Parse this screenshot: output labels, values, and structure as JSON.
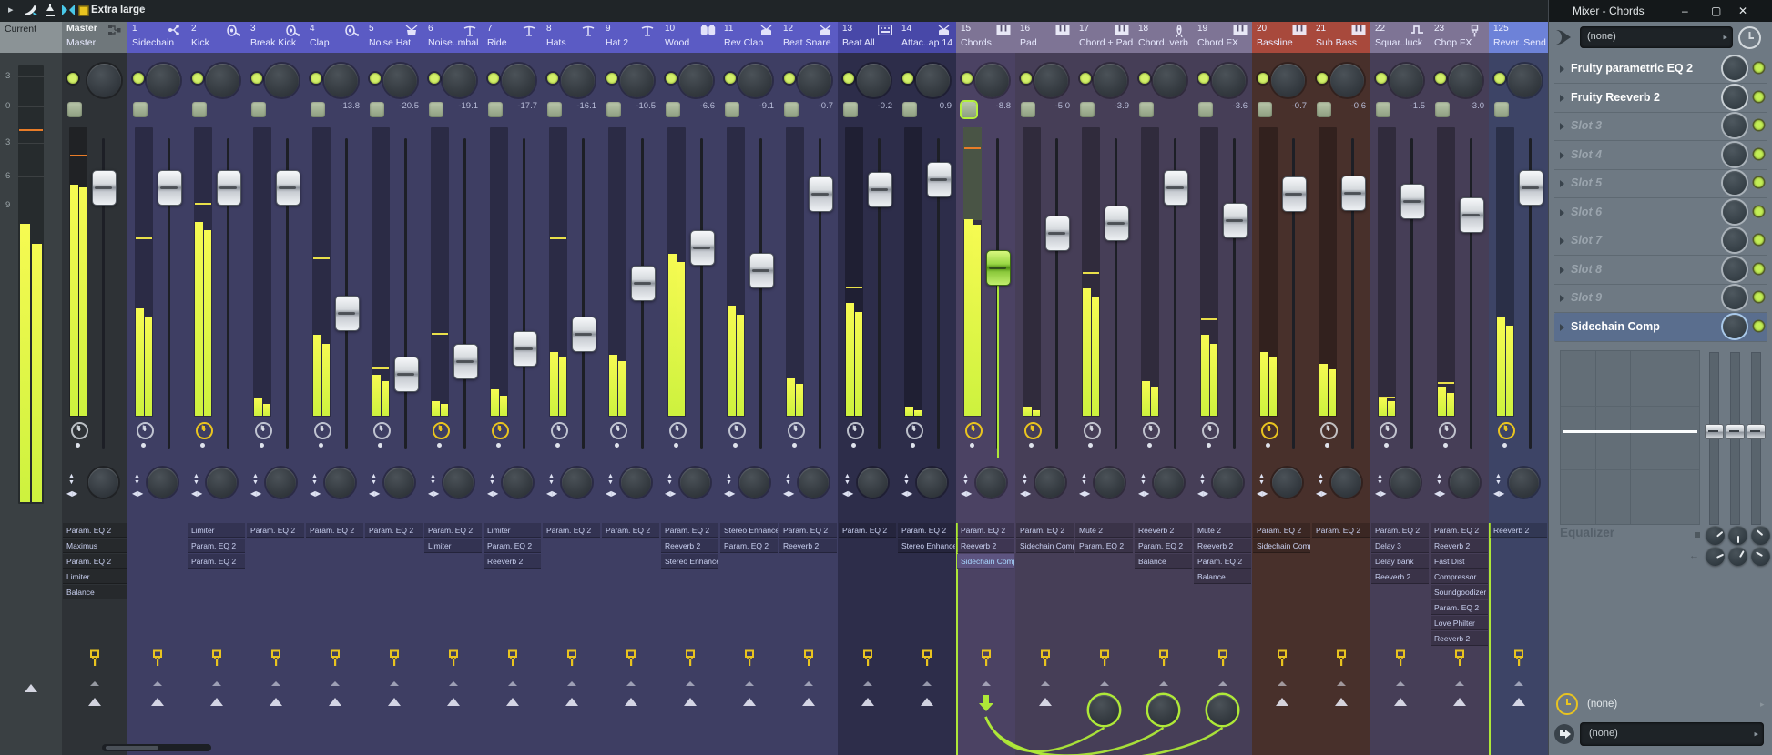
{
  "toolbar": {
    "view_label": "Extra large",
    "icons": [
      "play-arrow-icon",
      "swoosh-icon",
      "upload-icon",
      "scrub-icon",
      "square-icon",
      "chevron-right-icon"
    ]
  },
  "window": {
    "title": "Mixer - Chords",
    "buttons": {
      "minimize": "–",
      "maximize": "▢",
      "close": "✕"
    }
  },
  "colors": {
    "accent_green": "#aee838",
    "led": "#d3f06a",
    "peak_orange": "#e87c28",
    "group_a_header": "#5b5bc4",
    "group_a_body": "#3e3e63",
    "group_b_header": "#4848a8",
    "group_b_body": "#2d2d4a",
    "group_c_header": "#7e7495",
    "group_c_body": "#463e57",
    "group_d_header": "#a8493c",
    "group_d_body": "#48302b",
    "group_e_header": "#6d82d8",
    "group_e_body": "#3d4466",
    "mute_highlight": "#b4f03c"
  },
  "current_strip": {
    "label": "Current",
    "scale_marks": [
      "3",
      "0",
      "3",
      "6",
      "9"
    ],
    "meter": {
      "l": 0.635,
      "r": 0.59,
      "peak": 0.854
    }
  },
  "master": {
    "label": "Master",
    "name": "Master",
    "icon": "routing-icon",
    "db": null,
    "meter": {
      "l": 0.8,
      "r": 0.79,
      "peak": 0.905
    },
    "plugins": [
      "Param. EQ 2",
      "Maximus",
      "Param. EQ 2",
      "Limiter",
      "Balance"
    ],
    "clock_yellow": false
  },
  "channels": [
    {
      "num": "1",
      "name": "Sidechain",
      "icon": "fork",
      "group": "a",
      "db": null,
      "level_l": 0.37,
      "level_r": 0.34,
      "peak": 0.62,
      "clock_yellow": false,
      "plugins": [],
      "bottom": "arrows"
    },
    {
      "num": "2",
      "name": "Kick",
      "icon": "kick",
      "group": "a",
      "db": null,
      "level_l": 0.67,
      "level_r": 0.64,
      "peak": 0.74,
      "clock_yellow": true,
      "plugins": [
        "Limiter",
        "Param. EQ 2",
        "Param. EQ 2"
      ],
      "bottom": "arrows"
    },
    {
      "num": "3",
      "name": "Break Kick",
      "icon": "kick",
      "group": "a",
      "db": null,
      "level_l": 0.06,
      "level_r": 0.04,
      "peak": null,
      "clock_yellow": false,
      "plugins": [
        "Param. EQ 2"
      ],
      "bottom": "arrows"
    },
    {
      "num": "4",
      "name": "Clap",
      "icon": "kick",
      "group": "a",
      "db": "-13.8",
      "level_l": 0.28,
      "level_r": 0.25,
      "peak": 0.55,
      "clock_yellow": false,
      "plugins": [
        "Param. EQ 2"
      ],
      "bottom": "arrows"
    },
    {
      "num": "5",
      "name": "Noise Hat",
      "icon": "drum",
      "group": "a",
      "db": "-20.5",
      "level_l": 0.14,
      "level_r": 0.12,
      "peak": 0.17,
      "clock_yellow": false,
      "plugins": [
        "Param. EQ 2"
      ],
      "bottom": "arrows"
    },
    {
      "num": "6",
      "name": "Noise..mbal",
      "icon": "cymbal",
      "group": "a",
      "db": "-19.1",
      "level_l": 0.05,
      "level_r": 0.04,
      "peak": 0.29,
      "clock_yellow": true,
      "plugins": [
        "Param. EQ 2",
        "Limiter"
      ],
      "bottom": "arrows"
    },
    {
      "num": "7",
      "name": "Ride",
      "icon": "cymbal",
      "group": "a",
      "db": "-17.7",
      "level_l": 0.09,
      "level_r": 0.07,
      "peak": null,
      "clock_yellow": true,
      "plugins": [
        "Limiter",
        "Param. EQ 2",
        "Reeverb 2"
      ],
      "bottom": "arrows"
    },
    {
      "num": "8",
      "name": "Hats",
      "icon": "cymbal",
      "group": "a",
      "db": "-16.1",
      "level_l": 0.22,
      "level_r": 0.2,
      "peak": 0.62,
      "clock_yellow": false,
      "plugins": [
        "Param. EQ 2"
      ],
      "bottom": "arrows"
    },
    {
      "num": "9",
      "name": "Hat 2",
      "icon": "cymbal",
      "group": "a",
      "db": "-10.5",
      "level_l": 0.21,
      "level_r": 0.19,
      "peak": null,
      "clock_yellow": false,
      "plugins": [
        "Param. EQ 2"
      ],
      "bottom": "arrows"
    },
    {
      "num": "10",
      "name": "Wood",
      "icon": "bongo",
      "group": "a",
      "db": "-6.6",
      "level_l": 0.56,
      "level_r": 0.53,
      "peak": null,
      "clock_yellow": false,
      "plugins": [
        "Param. EQ 2",
        "Reeverb 2",
        "Stereo Enhancer"
      ],
      "bottom": "arrows"
    },
    {
      "num": "11",
      "name": "Rev Clap",
      "icon": "snare",
      "group": "a",
      "db": "-9.1",
      "level_l": 0.38,
      "level_r": 0.35,
      "peak": null,
      "clock_yellow": false,
      "plugins": [
        "Stereo Enhancer",
        "Param. EQ 2"
      ],
      "bottom": "arrows"
    },
    {
      "num": "12",
      "name": "Beat Snare",
      "icon": "snare",
      "group": "a",
      "db": "-0.7",
      "level_l": 0.13,
      "level_r": 0.11,
      "peak": null,
      "clock_yellow": false,
      "plugins": [
        "Param. EQ 2",
        "Reeverb 2"
      ],
      "bottom": "arrows"
    },
    {
      "num": "13",
      "name": "Beat All",
      "icon": "drummachine",
      "group": "b",
      "db": "-0.2",
      "level_l": 0.39,
      "level_r": 0.36,
      "peak": 0.45,
      "clock_yellow": false,
      "plugins": [
        "Param. EQ 2"
      ],
      "bottom": "arrows"
    },
    {
      "num": "14",
      "name": "Attac..ap 14",
      "icon": "snare",
      "group": "b",
      "db": "0.9",
      "level_l": 0.03,
      "level_r": 0.02,
      "peak": null,
      "clock_yellow": false,
      "plugins": [
        "Param. EQ 2",
        "Stereo Enhancer"
      ],
      "bottom": "arrows"
    },
    {
      "num": "15",
      "name": "Chords",
      "icon": "piano",
      "group": "c",
      "db": "-8.8",
      "level_l": 0.68,
      "level_r": 0.66,
      "peak": 0.93,
      "peak_orange": true,
      "clock_yellow": true,
      "selected": true,
      "mute_hl": true,
      "plugins": [
        "Param. EQ 2",
        "Reeverb 2",
        "Sidechain Comp"
      ],
      "selected_plugin": 2,
      "bottom": "send-source"
    },
    {
      "num": "16",
      "name": "Pad",
      "icon": "piano",
      "group": "c",
      "db": "-5.0",
      "level_l": 0.03,
      "level_r": 0.02,
      "peak": null,
      "clock_yellow": true,
      "plugins": [
        "Param. EQ 2",
        "Sidechain Comp"
      ],
      "bottom": "arrows"
    },
    {
      "num": "17",
      "name": "Chord + Pad",
      "icon": "piano",
      "group": "c",
      "db": "-3.9",
      "level_l": 0.44,
      "level_r": 0.41,
      "peak": 0.5,
      "clock_yellow": false,
      "plugins": [
        "Mute 2",
        "Param. EQ 2"
      ],
      "bottom": "send-knob"
    },
    {
      "num": "18",
      "name": "Chord..verb",
      "icon": "rocket",
      "group": "c",
      "db": null,
      "level_l": 0.12,
      "level_r": 0.1,
      "peak": null,
      "clock_yellow": false,
      "plugins": [
        "Reeverb 2",
        "Param. EQ 2",
        "Balance"
      ],
      "bottom": "send-knob"
    },
    {
      "num": "19",
      "name": "Chord FX",
      "icon": "piano",
      "group": "c",
      "db": "-3.6",
      "level_l": 0.28,
      "level_r": 0.25,
      "peak": 0.34,
      "clock_yellow": false,
      "plugins": [
        "Mute 2",
        "Reeverb 2",
        "Param. EQ 2",
        "Balance"
      ],
      "bottom": "send-knob"
    },
    {
      "num": "20",
      "name": "Bassline",
      "icon": "piano",
      "group": "d",
      "db": "-0.7",
      "level_l": 0.22,
      "level_r": 0.2,
      "peak": null,
      "clock_yellow": true,
      "plugins": [
        "Param. EQ 2",
        "Sidechain Comp"
      ],
      "bottom": "arrows"
    },
    {
      "num": "21",
      "name": "Sub Bass",
      "icon": "piano",
      "group": "d",
      "db": "-0.6",
      "level_l": 0.18,
      "level_r": 0.16,
      "peak": null,
      "clock_yellow": false,
      "plugins": [
        "Param. EQ 2"
      ],
      "bottom": "arrows"
    },
    {
      "num": "22",
      "name": "Squar..luck",
      "icon": "pulse",
      "group": "c",
      "db": "-1.5",
      "level_l": 0.06,
      "level_r": 0.05,
      "peak": 0.07,
      "clock_yellow": false,
      "plugins": [
        "Param. EQ 2",
        "Delay 3",
        "Delay bank",
        "Reeverb 2"
      ],
      "bottom": "arrows"
    },
    {
      "num": "23",
      "name": "Chop FX",
      "icon": "jack",
      "group": "c",
      "db": "-3.0",
      "level_l": 0.1,
      "level_r": 0.08,
      "peak": 0.12,
      "clock_yellow": false,
      "plugins": [
        "Param. EQ 2",
        "Reeverb 2",
        "Fast Dist",
        "Compressor",
        "Soundgoodizer",
        "Param. EQ 2",
        "Love Philter",
        "Reeverb 2"
      ],
      "bottom": "arrows"
    },
    {
      "num": "125",
      "name": "Rever..Send",
      "icon": null,
      "group": "e",
      "db": null,
      "level_l": 0.34,
      "level_r": 0.31,
      "peak": null,
      "clock_yellow": true,
      "plugins": [
        "Reeverb 2"
      ],
      "bottom": "arrows",
      "green_left": true
    }
  ],
  "sends": {
    "source_channel": "15",
    "target_channels": [
      "17",
      "18",
      "19"
    ]
  },
  "right_panel": {
    "input_select": "(none)",
    "slots": [
      {
        "name": "Fruity parametric EQ 2",
        "filled": true
      },
      {
        "name": "Fruity Reeverb 2",
        "filled": true
      },
      {
        "name": "Slot 3",
        "filled": false
      },
      {
        "name": "Slot 4",
        "filled": false
      },
      {
        "name": "Slot 5",
        "filled": false
      },
      {
        "name": "Slot 6",
        "filled": false
      },
      {
        "name": "Slot 7",
        "filled": false
      },
      {
        "name": "Slot 8",
        "filled": false
      },
      {
        "name": "Slot 9",
        "filled": false
      },
      {
        "name": "Sidechain Comp",
        "filled": true,
        "selected": true
      }
    ],
    "equalizer_label": "Equalizer",
    "time_select": "(none)",
    "output_select": "(none)"
  }
}
